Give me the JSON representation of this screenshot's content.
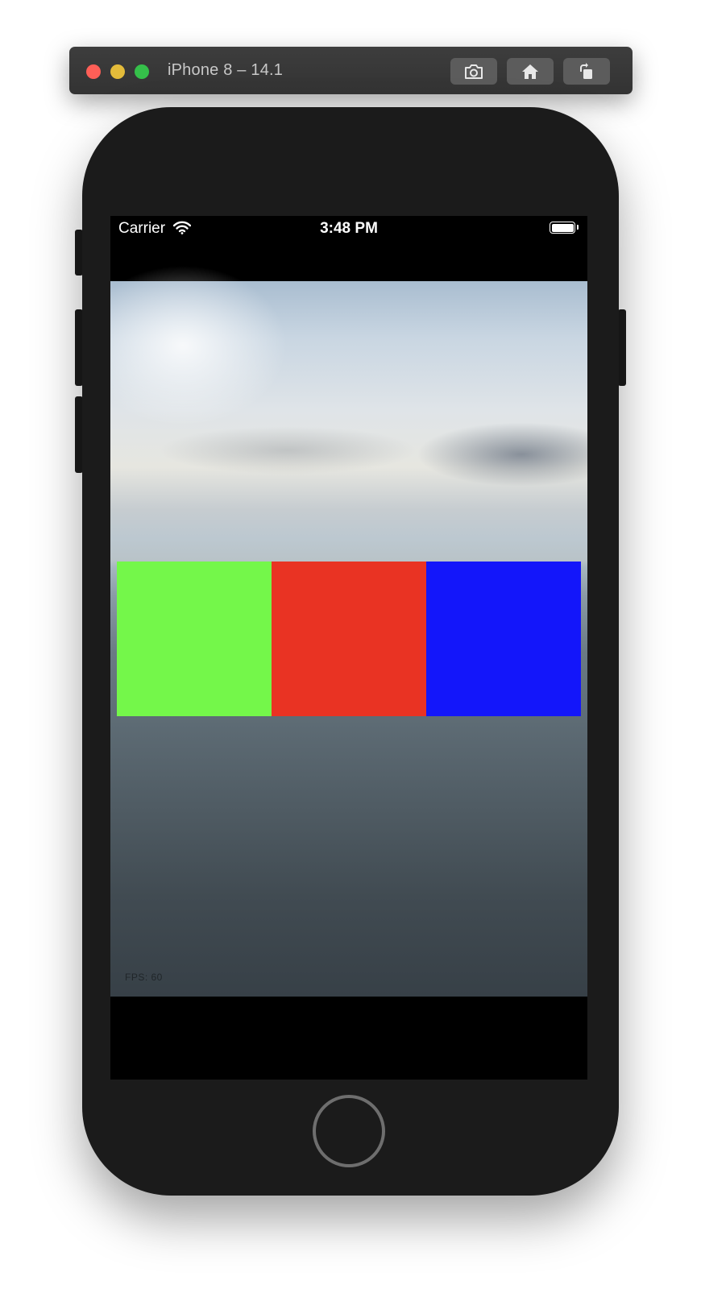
{
  "window": {
    "title": "iPhone 8 – 14.1",
    "buttons": {
      "screenshot_icon": "camera-icon",
      "home_icon": "home-icon",
      "rotate_icon": "rotate-icon"
    }
  },
  "status_bar": {
    "carrier": "Carrier",
    "time": "3:48 PM",
    "wifi_icon": "wifi-icon",
    "battery_icon": "battery-icon"
  },
  "scene": {
    "boxes": [
      {
        "name": "green",
        "color": "#74f74a"
      },
      {
        "name": "red",
        "color": "#e93323"
      },
      {
        "name": "blue",
        "color": "#1316fa"
      }
    ],
    "fps_label": "FPS: 60"
  },
  "colors": {
    "titlebar": "#3a3a3a",
    "device_body": "#1b1b1b",
    "screen": "#000000"
  }
}
